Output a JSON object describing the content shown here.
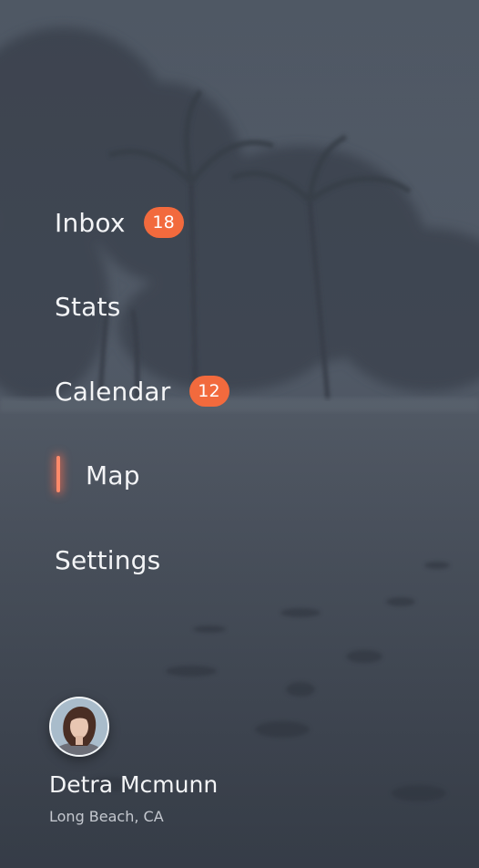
{
  "menu": {
    "items": [
      {
        "label": "Inbox",
        "badge": "18"
      },
      {
        "label": "Stats",
        "badge": null
      },
      {
        "label": "Calendar",
        "badge": "12"
      },
      {
        "label": "Map",
        "badge": null,
        "active": true
      },
      {
        "label": "Settings",
        "badge": null
      }
    ]
  },
  "profile": {
    "name": "Detra Mcmunn",
    "location": "Long Beach, CA"
  },
  "colors": {
    "badge": "#f26a3d",
    "active_indicator": "#ff8a6a",
    "text": "#f3f4f6"
  }
}
